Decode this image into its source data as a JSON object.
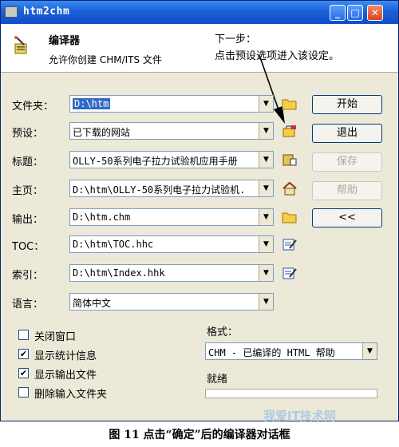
{
  "window": {
    "title": "htm2chm"
  },
  "header": {
    "title": "编译器",
    "description": "允许你创建 CHM/ITS 文件",
    "annotation_line1": "下一步：",
    "annotation_line2": "点击预设选项进入该设定。"
  },
  "fields": [
    {
      "label": "文件夹：",
      "value": "D:\\htm",
      "icon": "folder-open-icon",
      "selected": true
    },
    {
      "label": "预设：",
      "value": "已下载的网站",
      "icon": "preset-icon"
    },
    {
      "label": "标题：",
      "value": "OLLY-50系列电子拉力试验机应用手册",
      "icon": "title-book-icon"
    },
    {
      "label": "主页：",
      "value": "D:\\htm\\OLLY-50系列电子拉力试验机.",
      "icon": "home-icon"
    },
    {
      "label": "输出：",
      "value": "D:\\htm.chm",
      "icon": "folder-icon"
    },
    {
      "label": "TOC：",
      "value": "D:\\htm\\TOC.hhc",
      "icon": "edit-icon"
    },
    {
      "label": "索引：",
      "value": "D:\\htm\\Index.hhk",
      "icon": "edit-icon"
    },
    {
      "label": "语言：",
      "value": "简体中文"
    }
  ],
  "buttons": {
    "start": "开始",
    "exit": "退出",
    "save": "保存",
    "help": "帮助",
    "collapse": "<<"
  },
  "options": [
    {
      "label": "关闭窗口",
      "checked": false
    },
    {
      "label": "显示统计信息",
      "checked": true
    },
    {
      "label": "显示输出文件",
      "checked": true
    },
    {
      "label": "删除输入文件夹",
      "checked": false
    }
  ],
  "format": {
    "label": "格式：",
    "value": "CHM - 已编译的 HTML 帮助"
  },
  "status": {
    "label": "就绪",
    "progress": 0
  },
  "caption": "图 11  点击“确定”后的编译器对话框",
  "watermark": "我爱IT技术网",
  "colors": {
    "titlebar": "#0e4fc8",
    "dialog_bg": "#ece9d8",
    "selection": "#316ac5"
  }
}
